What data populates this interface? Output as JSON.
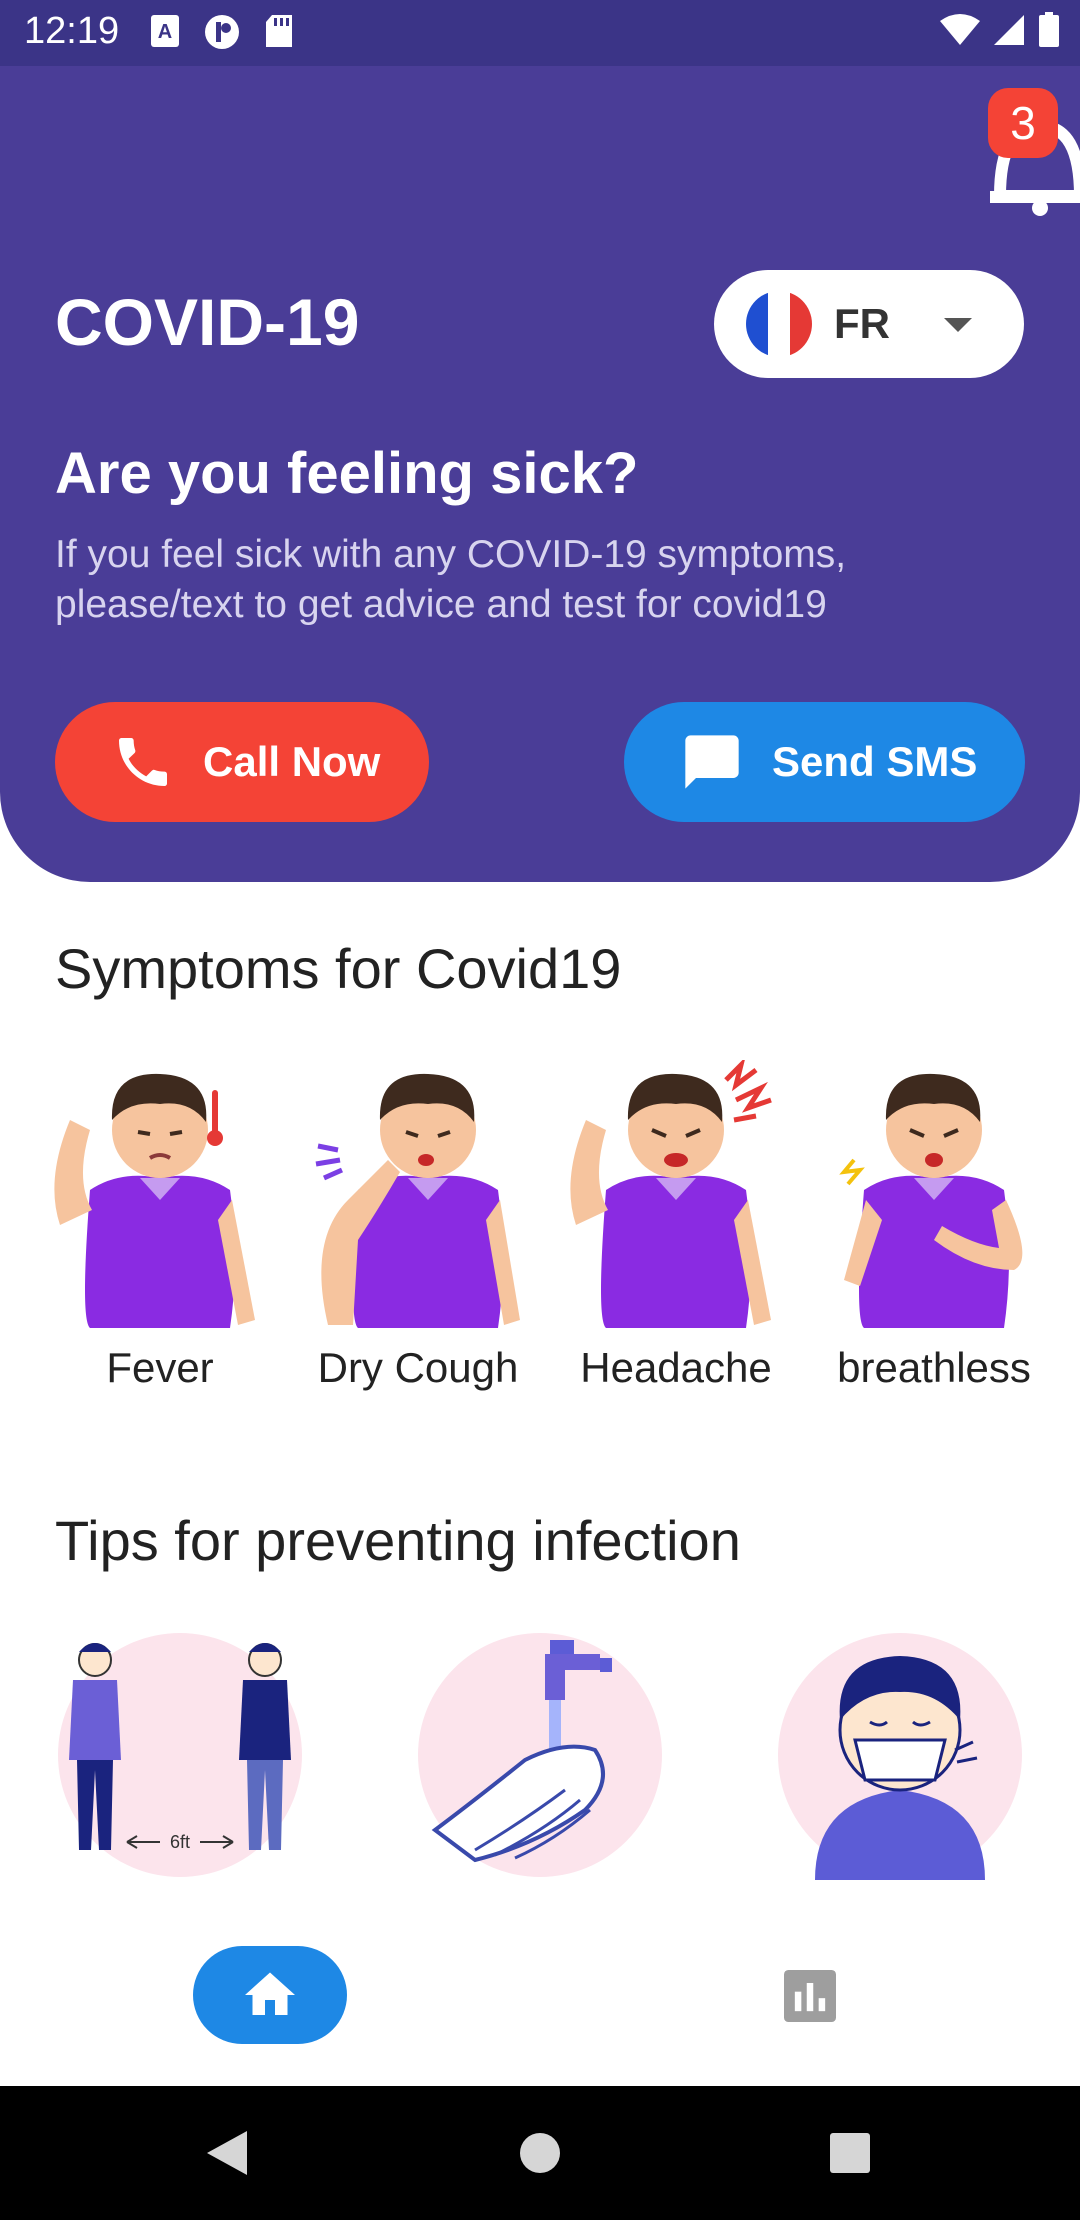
{
  "status_bar": {
    "time": "12:19",
    "left_icons": [
      "a-text-icon",
      "p-badge-icon",
      "sd-card-icon"
    ],
    "right_icons": [
      "wifi-icon",
      "signal-icon",
      "battery-icon"
    ]
  },
  "header": {
    "notification_count": "3",
    "title": "COVID-19",
    "language": {
      "code": "FR",
      "flag": "france-flag-icon"
    },
    "question": "Are you feeling sick?",
    "advice": "If you feel sick with any COVID-19 symptoms, please/text to get advice and test for covid19",
    "call_button": "Call Now",
    "sms_button": "Send SMS"
  },
  "symptoms": {
    "title": "Symptoms for Covid19",
    "items": [
      {
        "label": "Fever",
        "icon": "fever-illustration"
      },
      {
        "label": "Dry Cough",
        "icon": "dry-cough-illustration"
      },
      {
        "label": "Headache",
        "icon": "headache-illustration"
      },
      {
        "label": "breathless",
        "icon": "breathless-illustration"
      }
    ]
  },
  "tips": {
    "title": "Tips for preventing infection",
    "distance_label": "6ft",
    "items": [
      {
        "icon": "social-distance-illustration"
      },
      {
        "icon": "hand-washing-illustration"
      },
      {
        "icon": "face-mask-illustration"
      }
    ]
  },
  "bottom_nav": {
    "items": [
      {
        "icon": "home-icon",
        "active": true
      },
      {
        "icon": "bar-chart-icon",
        "active": false
      }
    ]
  },
  "colors": {
    "header_bg": "#4a3d97",
    "call_red": "#f44336",
    "sms_blue": "#1e88e5",
    "shirt_purple": "#8a2be2",
    "tip_circle": "#fce4ec"
  }
}
